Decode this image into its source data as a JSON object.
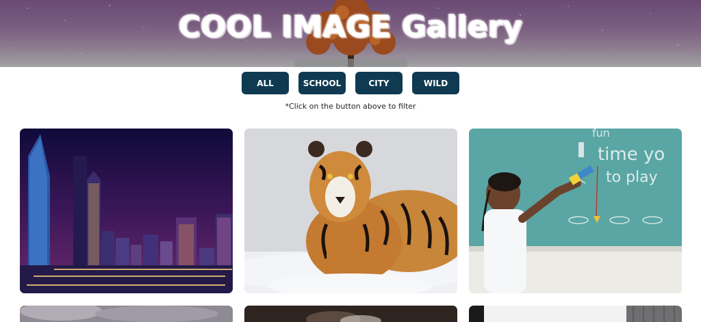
{
  "header": {
    "title": "COOL IMAGE Gallery"
  },
  "filters": [
    {
      "label": "ALL"
    },
    {
      "label": "SCHOOL"
    },
    {
      "label": "CITY"
    },
    {
      "label": "WILD"
    }
  ],
  "hint": "*Click on the button above to filter",
  "gallery": {
    "chalkboard_text_line1": "time yo",
    "chalkboard_text_line2": "to play",
    "chalkboard_text_top": "fun"
  },
  "colors": {
    "button_bg": "#0f3a52",
    "button_text": "#ffffff"
  }
}
